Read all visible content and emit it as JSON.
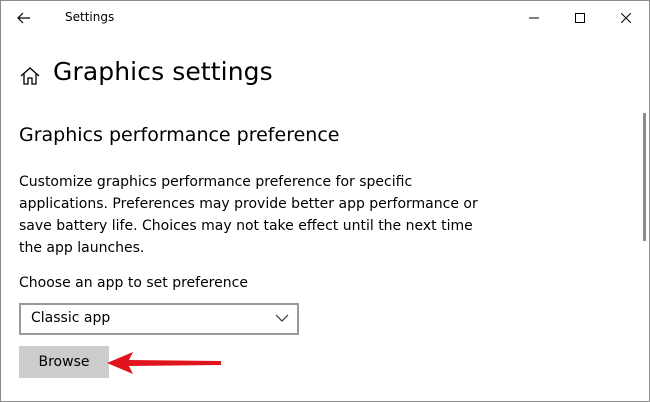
{
  "window": {
    "title": "Settings"
  },
  "page": {
    "title": "Graphics settings"
  },
  "section": {
    "title": "Graphics performance preference",
    "description": "Customize graphics performance preference for specific applications. Preferences may provide better app performance or save battery life. Choices may not take effect until the next time the app launches."
  },
  "app_chooser": {
    "label": "Choose an app to set preference",
    "selected": "Classic app",
    "browse_label": "Browse"
  },
  "icons": {
    "back": "back-arrow-icon",
    "home": "home-icon",
    "minimize": "minimize-icon",
    "maximize": "maximize-icon",
    "close": "close-icon",
    "chevron": "chevron-down-icon",
    "annotation": "red-arrow-annotation"
  },
  "colors": {
    "button_bg": "#cccccc",
    "dropdown_border": "#999999",
    "annotation_red": "#e0141c"
  }
}
